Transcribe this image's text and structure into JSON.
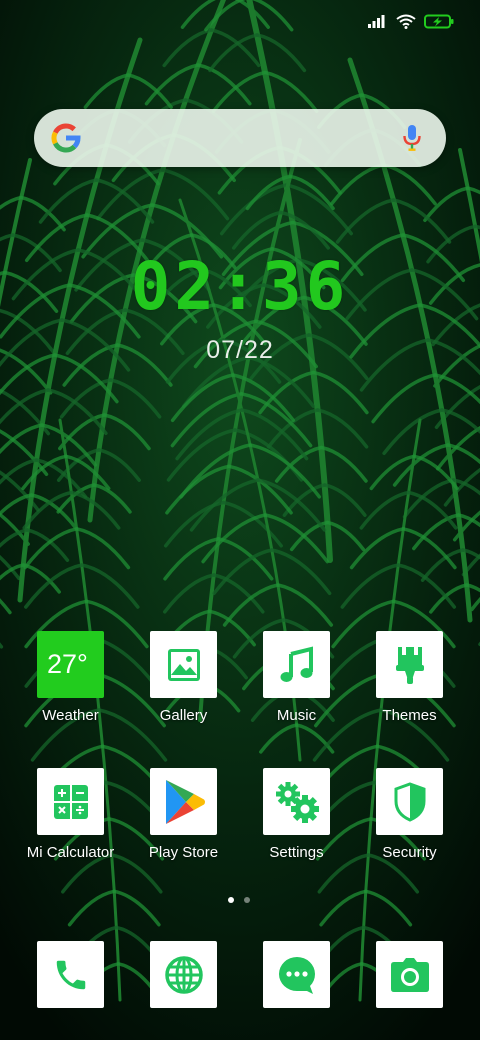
{
  "status_bar": {
    "signal_icon": "signal-bars-icon",
    "wifi_icon": "wifi-icon",
    "battery_icon": "battery-charging-icon",
    "accent": "#22cc1e"
  },
  "search_bar": {
    "logo_icon": "google-g-icon",
    "mic_icon": "microphone-icon"
  },
  "clock": {
    "time": "02:36",
    "date": "07/22",
    "color": "#22c81e"
  },
  "apps": [
    {
      "label": "Weather",
      "icon": "weather-icon",
      "tile_text": "27°"
    },
    {
      "label": "Gallery",
      "icon": "gallery-icon"
    },
    {
      "label": "Music",
      "icon": "music-note-icon"
    },
    {
      "label": "Themes",
      "icon": "paintbrush-icon"
    },
    {
      "label": "Mi Calculator",
      "icon": "calculator-icon"
    },
    {
      "label": "Play Store",
      "icon": "play-store-icon"
    },
    {
      "label": "Settings",
      "icon": "gears-icon"
    },
    {
      "label": "Security",
      "icon": "shield-icon"
    }
  ],
  "page_indicator": {
    "pages": 2,
    "active": 1
  },
  "dock": [
    {
      "name": "phone",
      "icon": "phone-icon"
    },
    {
      "name": "browser",
      "icon": "globe-icon"
    },
    {
      "name": "messages",
      "icon": "chat-bubble-icon"
    },
    {
      "name": "camera",
      "icon": "camera-icon"
    }
  ],
  "theme": {
    "icon_green": "#22c55e",
    "tile_bg": "#ffffff"
  }
}
